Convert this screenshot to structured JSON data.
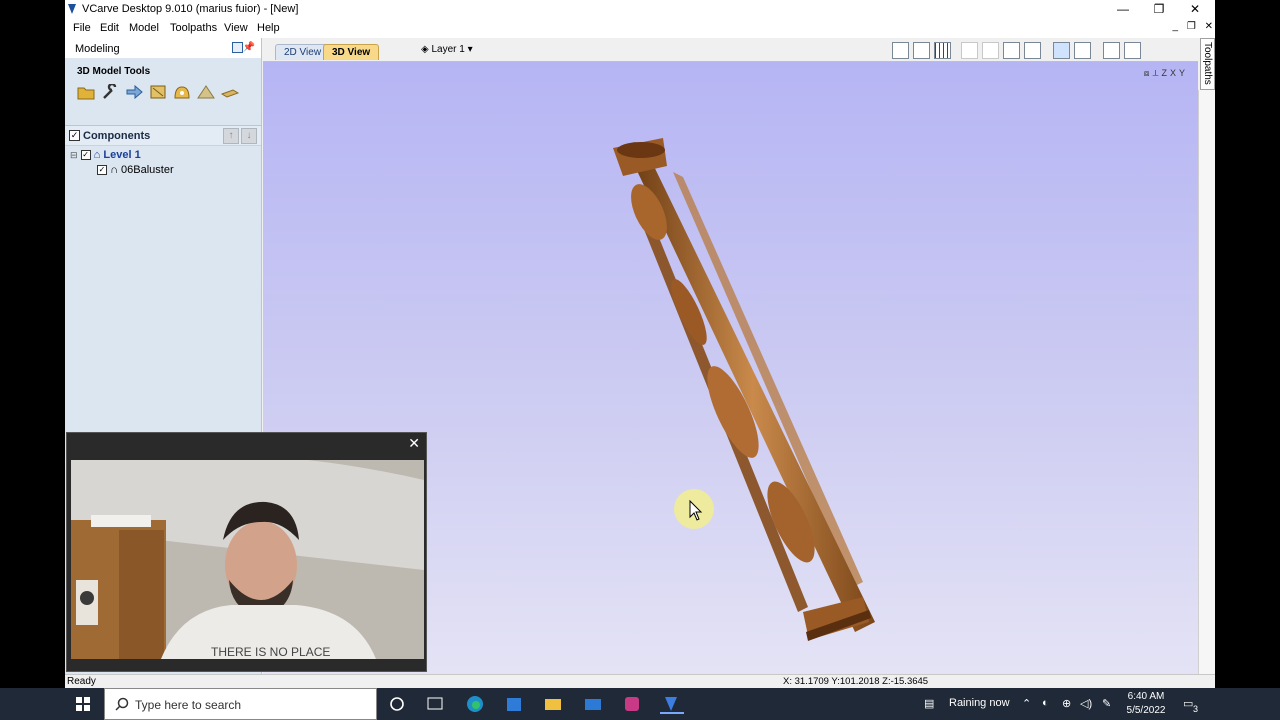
{
  "window": {
    "title": "VCarve Desktop 9.010 (marius fuior) - [New]",
    "controls": {
      "minimize": "—",
      "restore": "❐",
      "close": "✕"
    }
  },
  "menu": [
    "File",
    "Edit",
    "Model",
    "Toolpaths",
    "View",
    "Help"
  ],
  "mdi_controls": {
    "minimize": "_",
    "restore": "❐",
    "close": "✕"
  },
  "left_panel": {
    "header": "Modeling",
    "tools_title": "3D Model Tools",
    "tool_icons": [
      "folder-open-icon",
      "wrench-icon",
      "arrow-right-icon",
      "ruler-icon",
      "dome-icon",
      "cone-icon",
      "slice-icon"
    ],
    "components_title": "Components",
    "tree": [
      {
        "label": "Level 1",
        "type": "level",
        "checked": true
      },
      {
        "label": "06Baluster",
        "type": "component",
        "checked": true
      }
    ]
  },
  "view": {
    "tabs": [
      "2D View",
      "3D View"
    ],
    "active_tab": "3D View",
    "layer_label": "Layer 1",
    "right_tab": "Toolpaths"
  },
  "status": {
    "ready": "Ready",
    "coords": "X: 31.1709 Y:101.2018 Z:-15.3645"
  },
  "taskbar": {
    "search_placeholder": "Type here to search",
    "weather": "Raining now",
    "time": "6:40 AM",
    "date": "5/5/2022",
    "notification_count": "3"
  },
  "colors": {
    "view_top": "#b6b5f4",
    "view_bottom": "#e4e3f5",
    "wood": "#b4723a",
    "tab_active": "#f8d98a",
    "taskbar": "#1f2937"
  }
}
